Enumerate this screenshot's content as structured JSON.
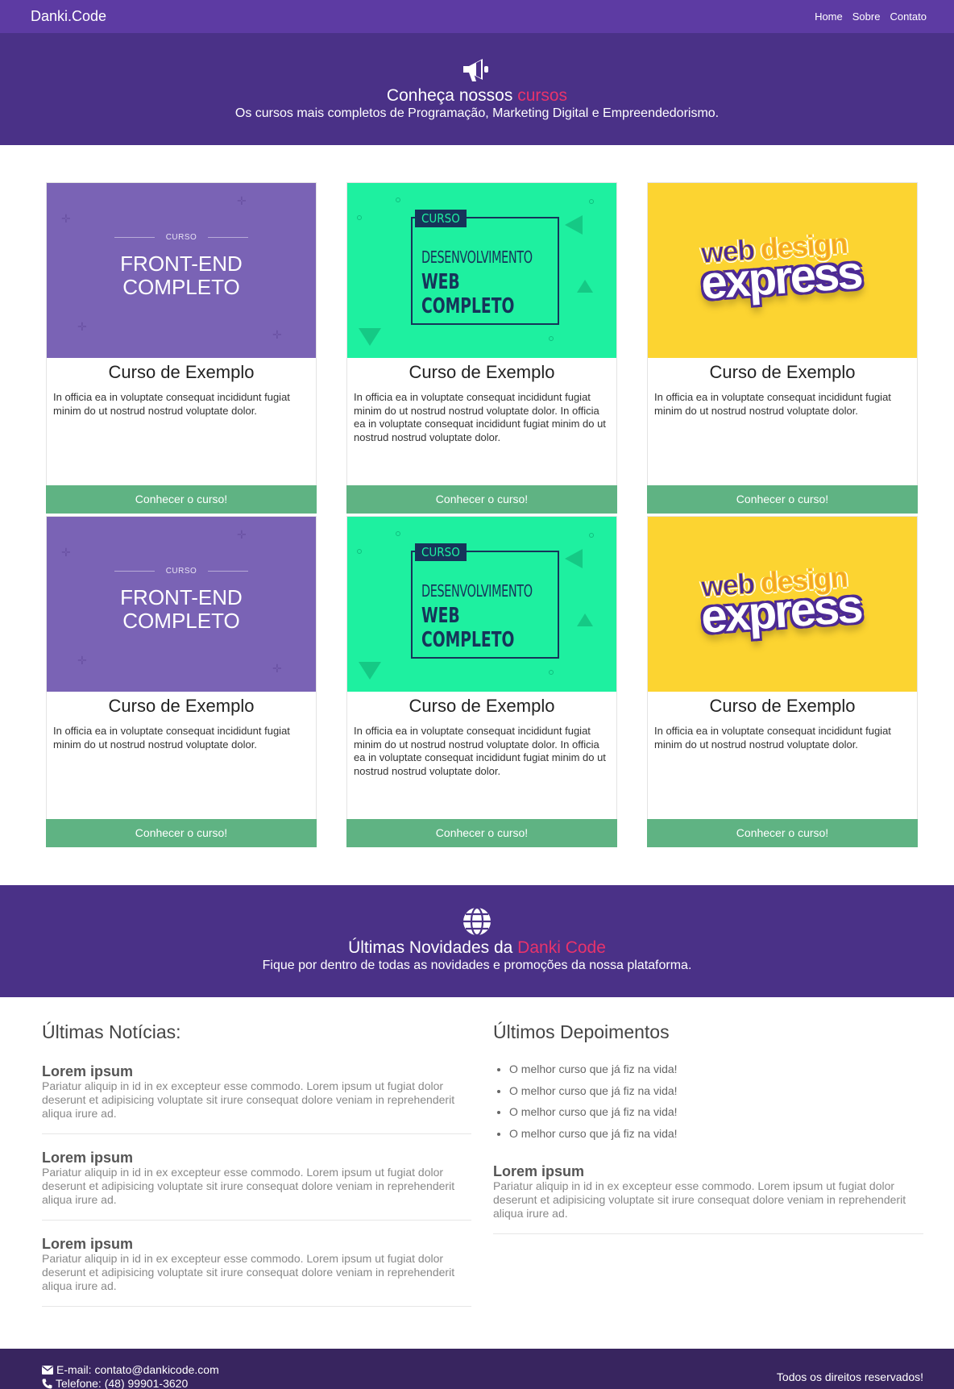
{
  "header": {
    "brand": "Danki.Code",
    "nav": [
      "Home",
      "Sobre",
      "Contato"
    ]
  },
  "hero": {
    "icon": "megaphone-icon",
    "title_prefix": "Conheça nossos ",
    "title_accent": "cursos",
    "subtitle": "Os cursos mais completos de Programação, Marketing Digital e Empreendedorismo."
  },
  "colors": {
    "nav_bg": "#5d3ba3",
    "banner_bg": "#4a3187",
    "accent": "#e8336b",
    "button_bg": "#5fb383",
    "footer_bg": "#38255f"
  },
  "thumb_art": {
    "frontend": {
      "small": "CURSO",
      "big1": "FRONT-END",
      "big2": "COMPLETO"
    },
    "webdev": {
      "tag": "CURSO",
      "l1": "DESENVOLVIMENTO",
      "l2": "WEB",
      "l3": "COMPLETO"
    },
    "webdesign": {
      "l1a": "web ",
      "l1b": "design",
      "l2": "express"
    }
  },
  "courses": [
    {
      "title": "Curso de Exemplo",
      "text": "In officia ea in voluptate consequat incididunt fugiat minim do ut nostrud nostrud voluptate dolor.",
      "button": "Conhecer o curso!"
    },
    {
      "title": "Curso de Exemplo",
      "text": "In officia ea in voluptate consequat incididunt fugiat minim do ut nostrud nostrud voluptate dolor. In officia ea in voluptate consequat incididunt fugiat minim do ut nostrud nostrud voluptate dolor.",
      "button": "Conhecer o curso!"
    },
    {
      "title": "Curso de Exemplo",
      "text": "In officia ea in voluptate consequat incididunt fugiat minim do ut nostrud nostrud voluptate dolor.",
      "button": "Conhecer o curso!"
    },
    {
      "title": "Curso de Exemplo",
      "text": "In officia ea in voluptate consequat incididunt fugiat minim do ut nostrud nostrud voluptate dolor.",
      "button": "Conhecer o curso!"
    },
    {
      "title": "Curso de Exemplo",
      "text": "In officia ea in voluptate consequat incididunt fugiat minim do ut nostrud nostrud voluptate dolor. In officia ea in voluptate consequat incididunt fugiat minim do ut nostrud nostrud voluptate dolor.",
      "button": "Conhecer o curso!"
    },
    {
      "title": "Curso de Exemplo",
      "text": "In officia ea in voluptate consequat incididunt fugiat minim do ut nostrud nostrud voluptate dolor.",
      "button": "Conhecer o curso!"
    }
  ],
  "updates": {
    "icon": "globe-icon",
    "title_prefix": "Últimas Novidades da ",
    "title_accent": "Danki Code",
    "subtitle": "Fique por dentro de todas as novidades e promoções da nossa plataforma."
  },
  "news": {
    "heading": "Últimas Notícias:",
    "posts": [
      {
        "title": "Lorem ipsum",
        "text": "Pariatur aliquip in id in ex excepteur esse commodo. Lorem ipsum ut fugiat dolor deserunt et adipisicing voluptate sit irure consequat dolore veniam in reprehenderit aliqua irure ad."
      },
      {
        "title": "Lorem ipsum",
        "text": "Pariatur aliquip in id in ex excepteur esse commodo. Lorem ipsum ut fugiat dolor deserunt et adipisicing voluptate sit irure consequat dolore veniam in reprehenderit aliqua irure ad."
      },
      {
        "title": "Lorem ipsum",
        "text": "Pariatur aliquip in id in ex excepteur esse commodo. Lorem ipsum ut fugiat dolor deserunt et adipisicing voluptate sit irure consequat dolore veniam in reprehenderit aliqua irure ad."
      }
    ]
  },
  "testimonials": {
    "heading": "Últimos Depoimentos",
    "items": [
      "O melhor curso que já fiz na vida!",
      "O melhor curso que já fiz na vida!",
      "O melhor curso que já fiz na vida!",
      "O melhor curso que já fiz na vida!"
    ],
    "post": {
      "title": "Lorem ipsum",
      "text": "Pariatur aliquip in id in ex excepteur esse commodo. Lorem ipsum ut fugiat dolor deserunt et adipisicing voluptate sit irure consequat dolore veniam in reprehenderit aliqua irure ad."
    }
  },
  "footer": {
    "email": "E-mail: contato@dankicode.com",
    "phone": "Telefone: (48) 99901-3620",
    "rights": "Todos os direitos reservados!"
  }
}
